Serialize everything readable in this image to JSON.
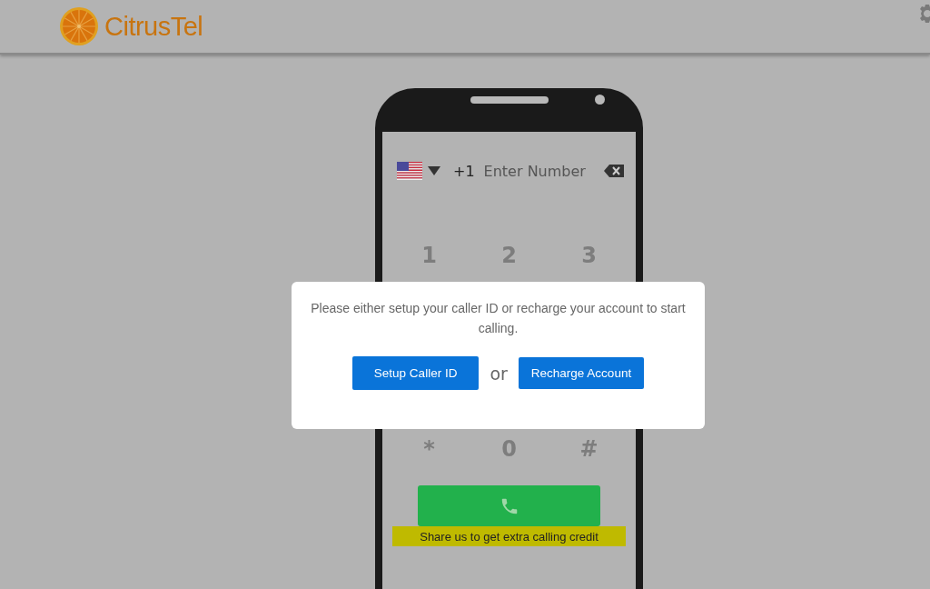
{
  "header": {
    "brand": "CitrusTel"
  },
  "dialer": {
    "country_code": "+1",
    "placeholder": "Enter Number",
    "keys": [
      [
        "1",
        "2",
        "3"
      ],
      [
        "*",
        "0",
        "#"
      ]
    ],
    "share_text": "Share us to get extra calling credit"
  },
  "dialog": {
    "message": "Please either setup your caller ID or recharge your account to start calling.",
    "buttons": [
      {
        "label": "Setup Caller ID"
      },
      {
        "label": "Recharge Account"
      }
    ],
    "separator": "or"
  }
}
